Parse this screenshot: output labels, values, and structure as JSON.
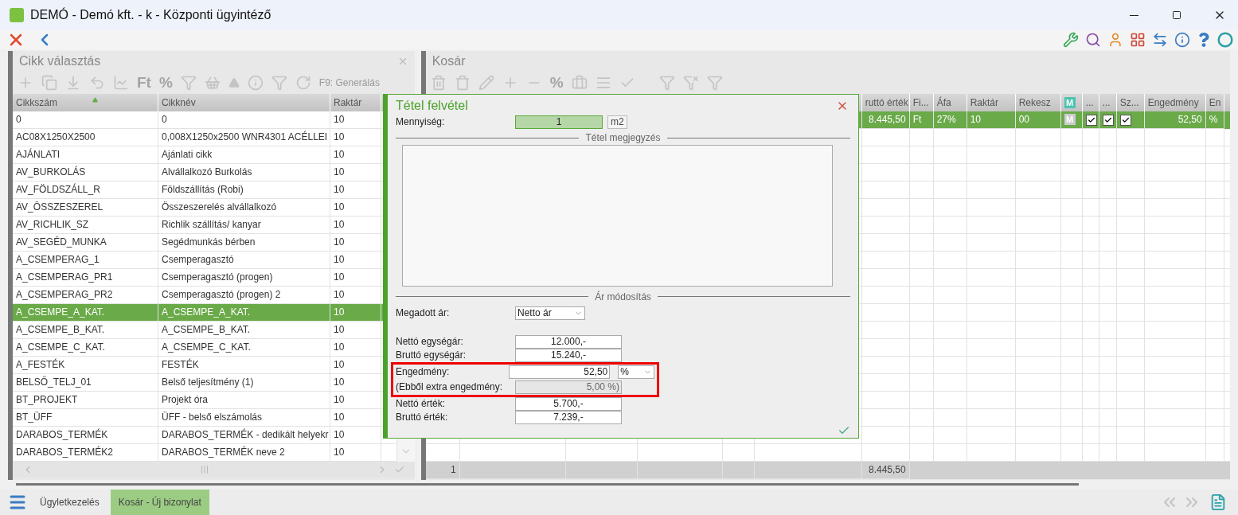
{
  "window": {
    "title": "DEMÓ - Demó kft. - k - Központi ügyintéző"
  },
  "left_panel": {
    "title": "Cikk választás",
    "toolbar": {
      "currency": "Ft",
      "percent": "%",
      "hint": "F9: Generálás"
    },
    "columns": [
      {
        "label": "Cikkszám",
        "sorted": true
      },
      {
        "label": "Cikknév",
        "sorted": false
      },
      {
        "label": "Raktár",
        "sorted": false
      }
    ],
    "rows": [
      {
        "code": "0",
        "name": "0",
        "stock": "10",
        "selected": false
      },
      {
        "code": "AC08X1250X2500",
        "name": "0,008X1250x2500 WNR4301 ACÉLLEI",
        "stock": "10",
        "selected": false
      },
      {
        "code": "AJÁNLATI",
        "name": "Ajánlati cikk",
        "stock": "10",
        "selected": false
      },
      {
        "code": "AV_BURKOLÁS",
        "name": "Alvállalkozó Burkolás",
        "stock": "10",
        "selected": false
      },
      {
        "code": "AV_FÖLDSZÁLL_R",
        "name": "Földszállítás (Robi)",
        "stock": "10",
        "selected": false
      },
      {
        "code": "AV_ÖSSZESZEREL",
        "name": "Összeszerelés alvállalkozó",
        "stock": "10",
        "selected": false
      },
      {
        "code": "AV_RICHLIK_SZ",
        "name": "Richlik szállítás/ kanyar",
        "stock": "10",
        "selected": false
      },
      {
        "code": "AV_SEGÉD_MUNKA",
        "name": "Segédmunkás bérben",
        "stock": "10",
        "selected": false
      },
      {
        "code": "A_CSEMPERAG_1",
        "name": "Csemperagasztó",
        "stock": "10",
        "selected": false
      },
      {
        "code": "A_CSEMPERAG_PR1",
        "name": "Csemperagasztó (progen)",
        "stock": "10",
        "selected": false
      },
      {
        "code": "A_CSEMPERAG_PR2",
        "name": "Csemperagasztó (progen) 2",
        "stock": "10",
        "selected": false
      },
      {
        "code": "A_CSEMPE_A_KAT.",
        "name": "A_CSEMPE_A_KAT.",
        "stock": "10",
        "selected": true
      },
      {
        "code": "A_CSEMPE_B_KAT.",
        "name": "A_CSEMPE_B_KAT.",
        "stock": "10",
        "selected": false
      },
      {
        "code": "A_CSEMPE_C_KAT.",
        "name": "A_CSEMPE_C_KAT.",
        "stock": "10",
        "selected": false
      },
      {
        "code": "A_FESTÉK",
        "name": "FESTÉK",
        "stock": "10",
        "selected": false
      },
      {
        "code": "BELSŐ_TELJ_01",
        "name": "Belső teljesítmény (1)",
        "stock": "10",
        "selected": false
      },
      {
        "code": "BT_PROJEKT",
        "name": "Projekt óra",
        "stock": "10",
        "selected": false
      },
      {
        "code": "BT_ÜFF",
        "name": "ÜFF - belső elszámolás",
        "stock": "10",
        "selected": false
      },
      {
        "code": "DARABOS_TERMÉK",
        "name": "DARABOS_TERMÉK - dedikált helyekr",
        "stock": "10",
        "selected": false
      },
      {
        "code": "DARABOS_TERMÉK2",
        "name": "DARABOS_TERMÉK neve 2",
        "stock": "10",
        "selected": false
      }
    ]
  },
  "right_panel": {
    "title": "Kosár",
    "toolbar": {
      "percent": "%"
    },
    "columns": [
      {
        "label": "ruttó érték",
        "kind": "text"
      },
      {
        "label": "Fi...",
        "kind": "text"
      },
      {
        "label": "Áfa",
        "kind": "text"
      },
      {
        "label": "Raktár",
        "kind": "text"
      },
      {
        "label": "Rekesz",
        "kind": "text"
      },
      {
        "label": "M",
        "kind": "badge"
      },
      {
        "label": "...",
        "kind": "text"
      },
      {
        "label": "...",
        "kind": "text"
      },
      {
        "label": "Sz...",
        "kind": "text"
      },
      {
        "label": "Engedmény",
        "kind": "text"
      },
      {
        "label": "En",
        "kind": "text"
      }
    ],
    "rows": [
      {
        "selected": true,
        "cells": [
          {
            "kind": "number",
            "value": "8.445,50"
          },
          {
            "kind": "text",
            "value": "Ft"
          },
          {
            "kind": "text",
            "value": "27%"
          },
          {
            "kind": "text",
            "value": "10"
          },
          {
            "kind": "text",
            "value": "00"
          },
          {
            "kind": "badge",
            "value": "M"
          },
          {
            "kind": "check",
            "checked": true
          },
          {
            "kind": "check",
            "checked": true
          },
          {
            "kind": "check",
            "checked": true
          },
          {
            "kind": "number",
            "value": "52,50"
          },
          {
            "kind": "text",
            "value": "%"
          }
        ]
      }
    ],
    "footer": {
      "count": "1",
      "total": "8.445,50"
    }
  },
  "dialog": {
    "title": "Tétel felvétel",
    "quantity": {
      "label": "Mennyiség:",
      "value": "1",
      "unit": "m2"
    },
    "note_section": "Tétel megjegyzés",
    "price_section": "Ár módosítás",
    "price_type": {
      "label": "Megadott ár:",
      "value": "Netto ár"
    },
    "fields": [
      {
        "kind": "input",
        "label": "Nettó egységár:",
        "value": "12.000,-",
        "highlighted": false
      },
      {
        "kind": "input",
        "label": "Bruttó egységár:",
        "value": "15.240,-",
        "highlighted": false
      },
      {
        "kind": "input_select",
        "label": "Engedmény:",
        "value": "52,50",
        "unit": "%",
        "highlighted": true
      },
      {
        "kind": "readonly",
        "label": "(Ebből extra engedmény:",
        "value": "5,00 %)",
        "highlighted": true
      },
      {
        "kind": "input",
        "label": "Nettó érték:",
        "value": "5.700,-",
        "highlighted": false
      },
      {
        "kind": "input",
        "label": "Bruttó érték:",
        "value": "7.239,-",
        "highlighted": false
      }
    ]
  },
  "bottom_tabs": [
    {
      "label": "Ügyletkezelés",
      "selected": false
    },
    {
      "label": "Kosár - Új bizonylat",
      "selected": true
    }
  ]
}
